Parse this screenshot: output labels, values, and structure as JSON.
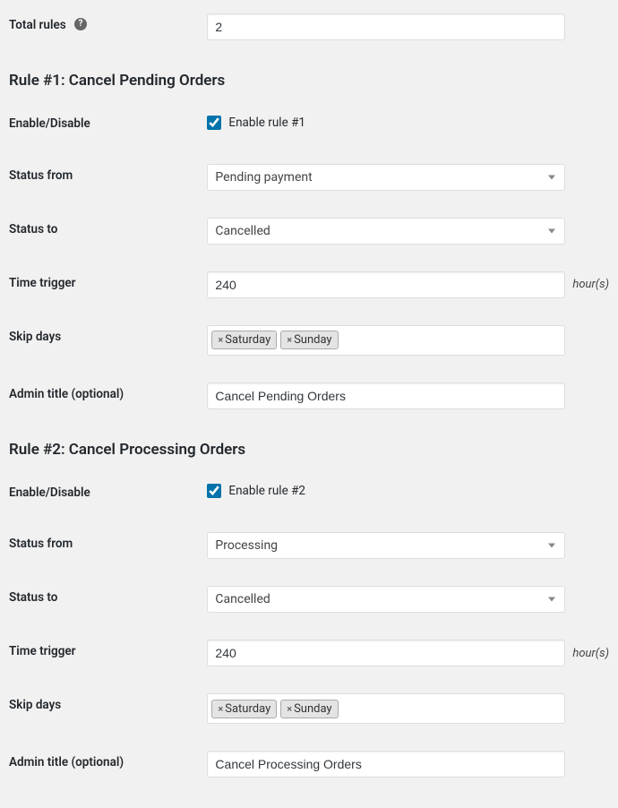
{
  "totalRules": {
    "label": "Total rules",
    "value": "2"
  },
  "rule1": {
    "heading": "Rule #1: Cancel Pending Orders",
    "enable": {
      "label": "Enable/Disable",
      "cbLabel": "Enable rule #1",
      "checked": true
    },
    "statusFrom": {
      "label": "Status from",
      "value": "Pending payment"
    },
    "statusTo": {
      "label": "Status to",
      "value": "Cancelled"
    },
    "timeTrigger": {
      "label": "Time trigger",
      "value": "240",
      "unit": "hour(s)"
    },
    "skipDays": {
      "label": "Skip days",
      "tags": [
        "Saturday",
        "Sunday"
      ]
    },
    "adminTitle": {
      "label": "Admin title (optional)",
      "value": "Cancel Pending Orders"
    }
  },
  "rule2": {
    "heading": "Rule #2: Cancel Processing Orders",
    "enable": {
      "label": "Enable/Disable",
      "cbLabel": "Enable rule #2",
      "checked": true
    },
    "statusFrom": {
      "label": "Status from",
      "value": "Processing"
    },
    "statusTo": {
      "label": "Status to",
      "value": "Cancelled"
    },
    "timeTrigger": {
      "label": "Time trigger",
      "value": "240",
      "unit": "hour(s)"
    },
    "skipDays": {
      "label": "Skip days",
      "tags": [
        "Saturday",
        "Sunday"
      ]
    },
    "adminTitle": {
      "label": "Admin title (optional)",
      "value": "Cancel Processing Orders"
    }
  }
}
